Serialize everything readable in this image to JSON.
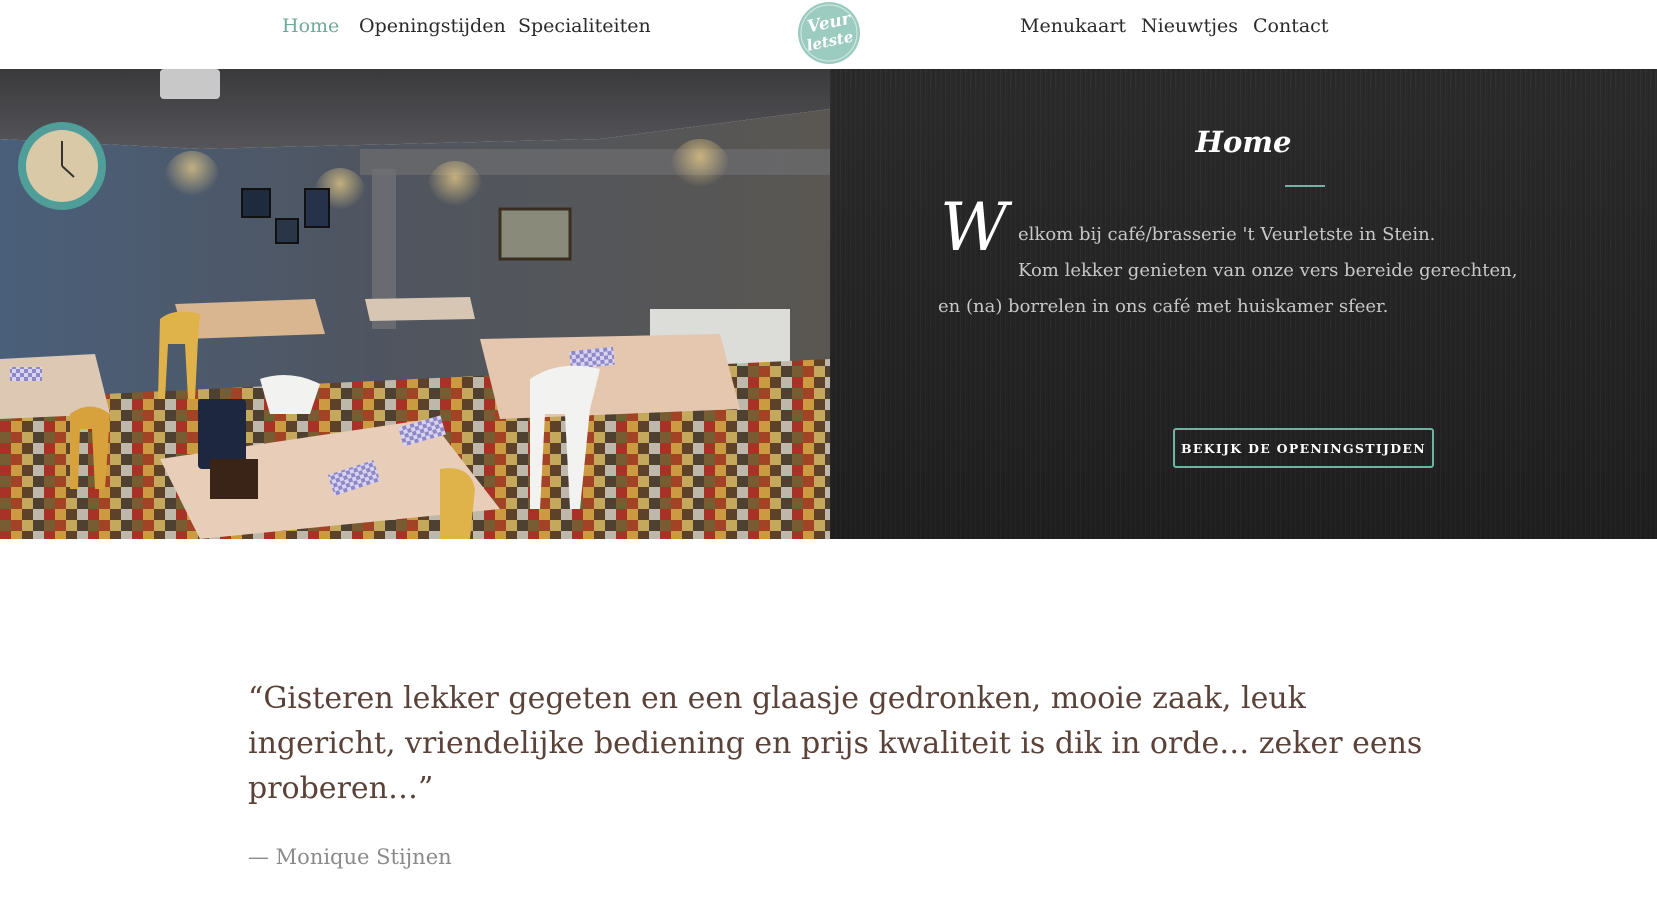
{
  "nav": {
    "left_items": [
      {
        "label": "Home",
        "active": true
      },
      {
        "label": "Openingstijden",
        "active": false
      },
      {
        "label": "Specialiteiten",
        "active": false
      }
    ],
    "right_items": [
      {
        "label": "Menukaart",
        "active": false
      },
      {
        "label": "Nieuwtjes",
        "active": false
      },
      {
        "label": "Contact",
        "active": false
      }
    ],
    "logo_text": [
      "Veur",
      "letste"
    ],
    "active_color": "#6fa99a"
  },
  "hero": {
    "photo_icon": "restaurant-interior-photo",
    "title": "Home",
    "dropcap": "W",
    "intro_lines": [
      "elkom bij café/brasserie 't Veurletste in Stein.",
      "Kom lekker genieten van onze vers bereide gerechten,",
      "en (na) borrelen in ons café met huiskamer sfeer."
    ],
    "cta_label": "BEKIJK DE OPENINGSTIJDEN",
    "accent_color": "#6fb3a2"
  },
  "testimonial": {
    "quote": "“Gisteren lekker gegeten en een glaasje gedronken, mooie zaak, leuk ingericht, vriendelijke bediening en prijs kwaliteit is dik in orde… zeker eens proberen…”",
    "author": "— Monique Stijnen"
  }
}
